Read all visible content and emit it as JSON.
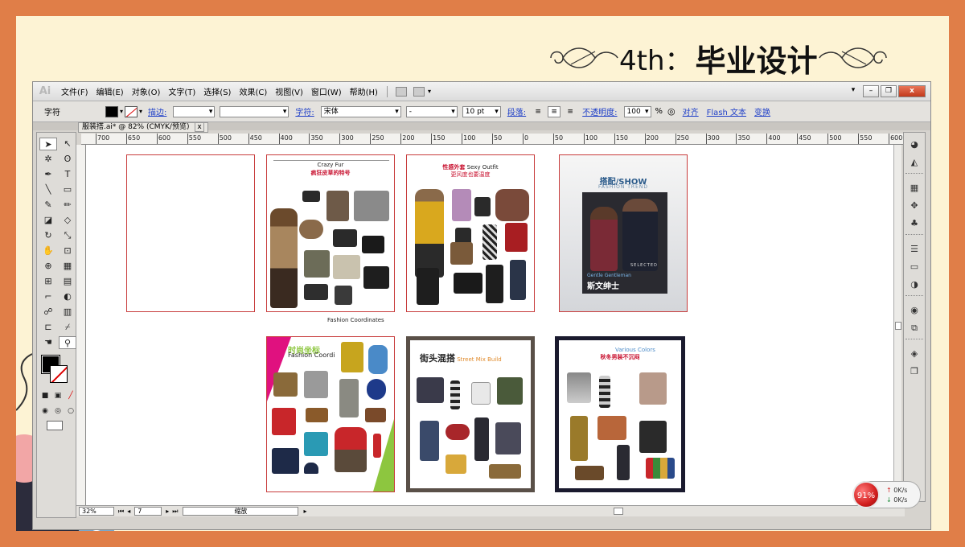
{
  "slide": {
    "title_num": "4th：",
    "title_zh": "毕业设计"
  },
  "app": {
    "logo": "Ai",
    "menu": [
      "文件(F)",
      "编辑(E)",
      "对象(O)",
      "文字(T)",
      "选择(S)",
      "效果(C)",
      "视图(V)",
      "窗口(W)",
      "帮助(H)"
    ],
    "window_buttons": [
      "▾",
      "–",
      "❐",
      "x"
    ]
  },
  "control_bar": {
    "mode_label": "字符",
    "stroke_link": "描边:",
    "char_link": "字符:",
    "font_family": "宋体",
    "font_style": "-",
    "font_size": "10 pt",
    "para_link": "段落:",
    "opacity_link": "不透明度:",
    "opacity_value": "100",
    "opacity_unit": "%",
    "align_link": "对齐",
    "flash_link": "Flash 文本",
    "transform_link": "变换"
  },
  "document": {
    "tab_title": "服装搭.ai* @ 82% (CMYK/预览)",
    "tab_close": "x"
  },
  "ruler": {
    "labels": [
      "700",
      "650",
      "600",
      "550",
      "500",
      "450",
      "400",
      "350",
      "300",
      "250",
      "200",
      "150",
      "100",
      "50",
      "0",
      "50",
      "100",
      "150",
      "200",
      "250",
      "300",
      "350",
      "400",
      "450",
      "500",
      "550",
      "600"
    ]
  },
  "artboards": {
    "crazy_fur": {
      "title_en": "Crazy Fur",
      "title_zh": "疯狂皮草的特号",
      "caption": "Fashion Coordinates"
    },
    "sexy_outfit": {
      "title_zh": "性感外套",
      "title_en": "Sexy Outfit",
      "subtitle": "更风度也要温度"
    },
    "show": {
      "title": "搭配/SHOW",
      "subtitle": "FASHION TREND",
      "brand": "SELECTED",
      "tag_en": "Gentle Gentleman",
      "tag_zh": "斯文绅士"
    },
    "fashion_coord": {
      "title_zh": "时尚坐标",
      "title_en": "Fashion Coordi"
    },
    "street_mix": {
      "title_zh": "街头混搭",
      "title_en": "Street Mix Build"
    },
    "various_colors": {
      "title_zh": "秋冬男装不沉闷",
      "title_en": "Various Colors"
    }
  },
  "status_bar": {
    "zoom": "32%",
    "page": "7",
    "status_text": "缩放"
  },
  "net_widget": {
    "percent": "91%",
    "up_label": "0K/s",
    "down_label": "0K/s"
  },
  "colors": {
    "border_orange": "#E07E48",
    "slide_bg": "#FDF3D4",
    "artboard_border": "#C83C3C",
    "link_blue": "#1E3FC8"
  }
}
